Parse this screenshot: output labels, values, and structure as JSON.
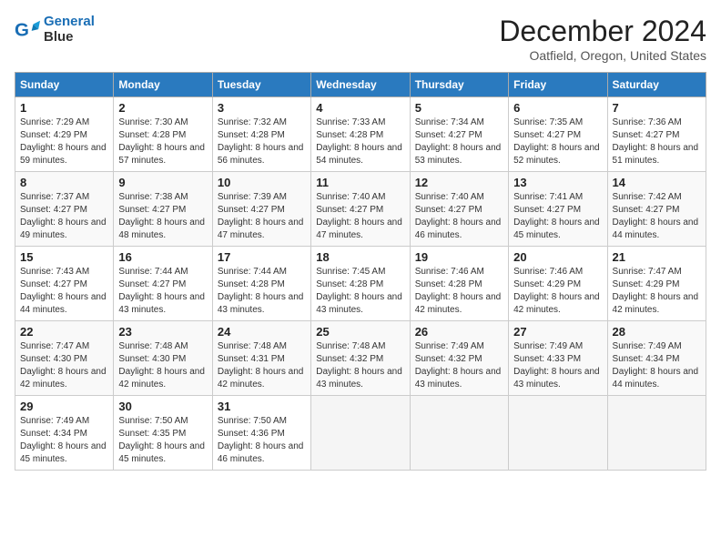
{
  "header": {
    "logo_text_1": "General",
    "logo_text_2": "Blue",
    "month_title": "December 2024",
    "location": "Oatfield, Oregon, United States"
  },
  "calendar": {
    "headers": [
      "Sunday",
      "Monday",
      "Tuesday",
      "Wednesday",
      "Thursday",
      "Friday",
      "Saturday"
    ],
    "weeks": [
      [
        {
          "day": "1",
          "sunrise": "7:29 AM",
          "sunset": "4:29 PM",
          "daylight": "8 hours and 59 minutes."
        },
        {
          "day": "2",
          "sunrise": "7:30 AM",
          "sunset": "4:28 PM",
          "daylight": "8 hours and 57 minutes."
        },
        {
          "day": "3",
          "sunrise": "7:32 AM",
          "sunset": "4:28 PM",
          "daylight": "8 hours and 56 minutes."
        },
        {
          "day": "4",
          "sunrise": "7:33 AM",
          "sunset": "4:28 PM",
          "daylight": "8 hours and 54 minutes."
        },
        {
          "day": "5",
          "sunrise": "7:34 AM",
          "sunset": "4:27 PM",
          "daylight": "8 hours and 53 minutes."
        },
        {
          "day": "6",
          "sunrise": "7:35 AM",
          "sunset": "4:27 PM",
          "daylight": "8 hours and 52 minutes."
        },
        {
          "day": "7",
          "sunrise": "7:36 AM",
          "sunset": "4:27 PM",
          "daylight": "8 hours and 51 minutes."
        }
      ],
      [
        {
          "day": "8",
          "sunrise": "7:37 AM",
          "sunset": "4:27 PM",
          "daylight": "8 hours and 49 minutes."
        },
        {
          "day": "9",
          "sunrise": "7:38 AM",
          "sunset": "4:27 PM",
          "daylight": "8 hours and 48 minutes."
        },
        {
          "day": "10",
          "sunrise": "7:39 AM",
          "sunset": "4:27 PM",
          "daylight": "8 hours and 47 minutes."
        },
        {
          "day": "11",
          "sunrise": "7:40 AM",
          "sunset": "4:27 PM",
          "daylight": "8 hours and 47 minutes."
        },
        {
          "day": "12",
          "sunrise": "7:40 AM",
          "sunset": "4:27 PM",
          "daylight": "8 hours and 46 minutes."
        },
        {
          "day": "13",
          "sunrise": "7:41 AM",
          "sunset": "4:27 PM",
          "daylight": "8 hours and 45 minutes."
        },
        {
          "day": "14",
          "sunrise": "7:42 AM",
          "sunset": "4:27 PM",
          "daylight": "8 hours and 44 minutes."
        }
      ],
      [
        {
          "day": "15",
          "sunrise": "7:43 AM",
          "sunset": "4:27 PM",
          "daylight": "8 hours and 44 minutes."
        },
        {
          "day": "16",
          "sunrise": "7:44 AM",
          "sunset": "4:27 PM",
          "daylight": "8 hours and 43 minutes."
        },
        {
          "day": "17",
          "sunrise": "7:44 AM",
          "sunset": "4:28 PM",
          "daylight": "8 hours and 43 minutes."
        },
        {
          "day": "18",
          "sunrise": "7:45 AM",
          "sunset": "4:28 PM",
          "daylight": "8 hours and 43 minutes."
        },
        {
          "day": "19",
          "sunrise": "7:46 AM",
          "sunset": "4:28 PM",
          "daylight": "8 hours and 42 minutes."
        },
        {
          "day": "20",
          "sunrise": "7:46 AM",
          "sunset": "4:29 PM",
          "daylight": "8 hours and 42 minutes."
        },
        {
          "day": "21",
          "sunrise": "7:47 AM",
          "sunset": "4:29 PM",
          "daylight": "8 hours and 42 minutes."
        }
      ],
      [
        {
          "day": "22",
          "sunrise": "7:47 AM",
          "sunset": "4:30 PM",
          "daylight": "8 hours and 42 minutes."
        },
        {
          "day": "23",
          "sunrise": "7:48 AM",
          "sunset": "4:30 PM",
          "daylight": "8 hours and 42 minutes."
        },
        {
          "day": "24",
          "sunrise": "7:48 AM",
          "sunset": "4:31 PM",
          "daylight": "8 hours and 42 minutes."
        },
        {
          "day": "25",
          "sunrise": "7:48 AM",
          "sunset": "4:32 PM",
          "daylight": "8 hours and 43 minutes."
        },
        {
          "day": "26",
          "sunrise": "7:49 AM",
          "sunset": "4:32 PM",
          "daylight": "8 hours and 43 minutes."
        },
        {
          "day": "27",
          "sunrise": "7:49 AM",
          "sunset": "4:33 PM",
          "daylight": "8 hours and 43 minutes."
        },
        {
          "day": "28",
          "sunrise": "7:49 AM",
          "sunset": "4:34 PM",
          "daylight": "8 hours and 44 minutes."
        }
      ],
      [
        {
          "day": "29",
          "sunrise": "7:49 AM",
          "sunset": "4:34 PM",
          "daylight": "8 hours and 45 minutes."
        },
        {
          "day": "30",
          "sunrise": "7:50 AM",
          "sunset": "4:35 PM",
          "daylight": "8 hours and 45 minutes."
        },
        {
          "day": "31",
          "sunrise": "7:50 AM",
          "sunset": "4:36 PM",
          "daylight": "8 hours and 46 minutes."
        },
        null,
        null,
        null,
        null
      ]
    ],
    "labels": {
      "sunrise": "Sunrise:",
      "sunset": "Sunset:",
      "daylight": "Daylight:"
    }
  }
}
